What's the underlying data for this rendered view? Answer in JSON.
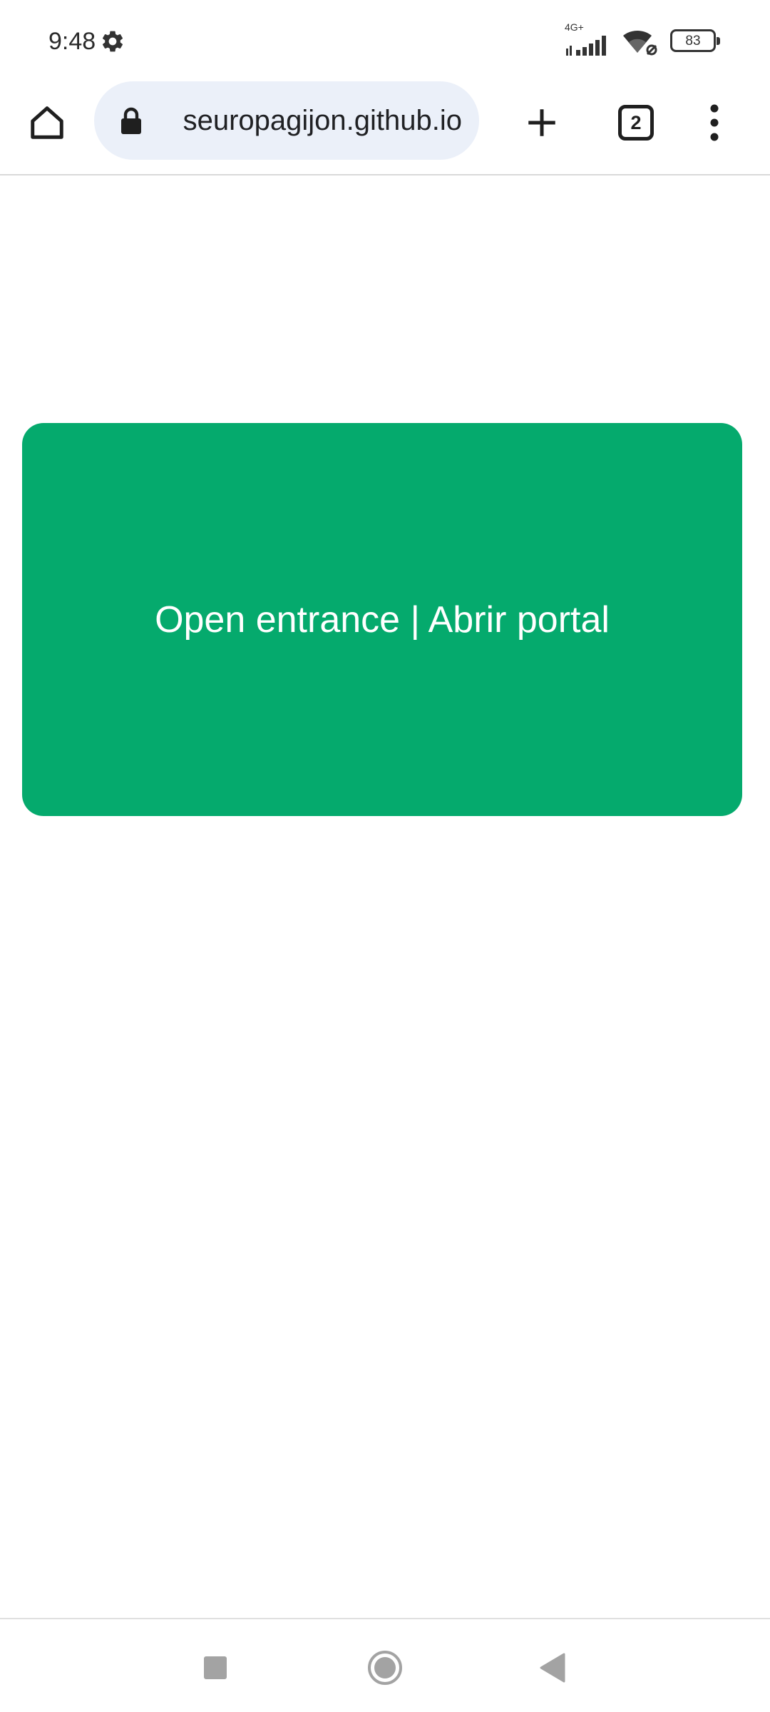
{
  "status_bar": {
    "time": "9:48",
    "network": "4G+",
    "battery": "83",
    "icons": [
      "settings-gear-icon",
      "cell-signal-icon",
      "wifi-icon",
      "battery-icon"
    ]
  },
  "browser": {
    "url": "seuropagijon.github.io",
    "tab_count": "2",
    "icons": [
      "home-icon",
      "lock-icon",
      "plus-icon",
      "tab-switcher-icon",
      "more-vert-icon"
    ]
  },
  "page": {
    "button_label": "Open entrance | Abrir portal",
    "button_color": "#05aa6d"
  },
  "nav_bar": {
    "icons": [
      "recents-square-icon",
      "home-circle-icon",
      "back-triangle-icon"
    ]
  }
}
